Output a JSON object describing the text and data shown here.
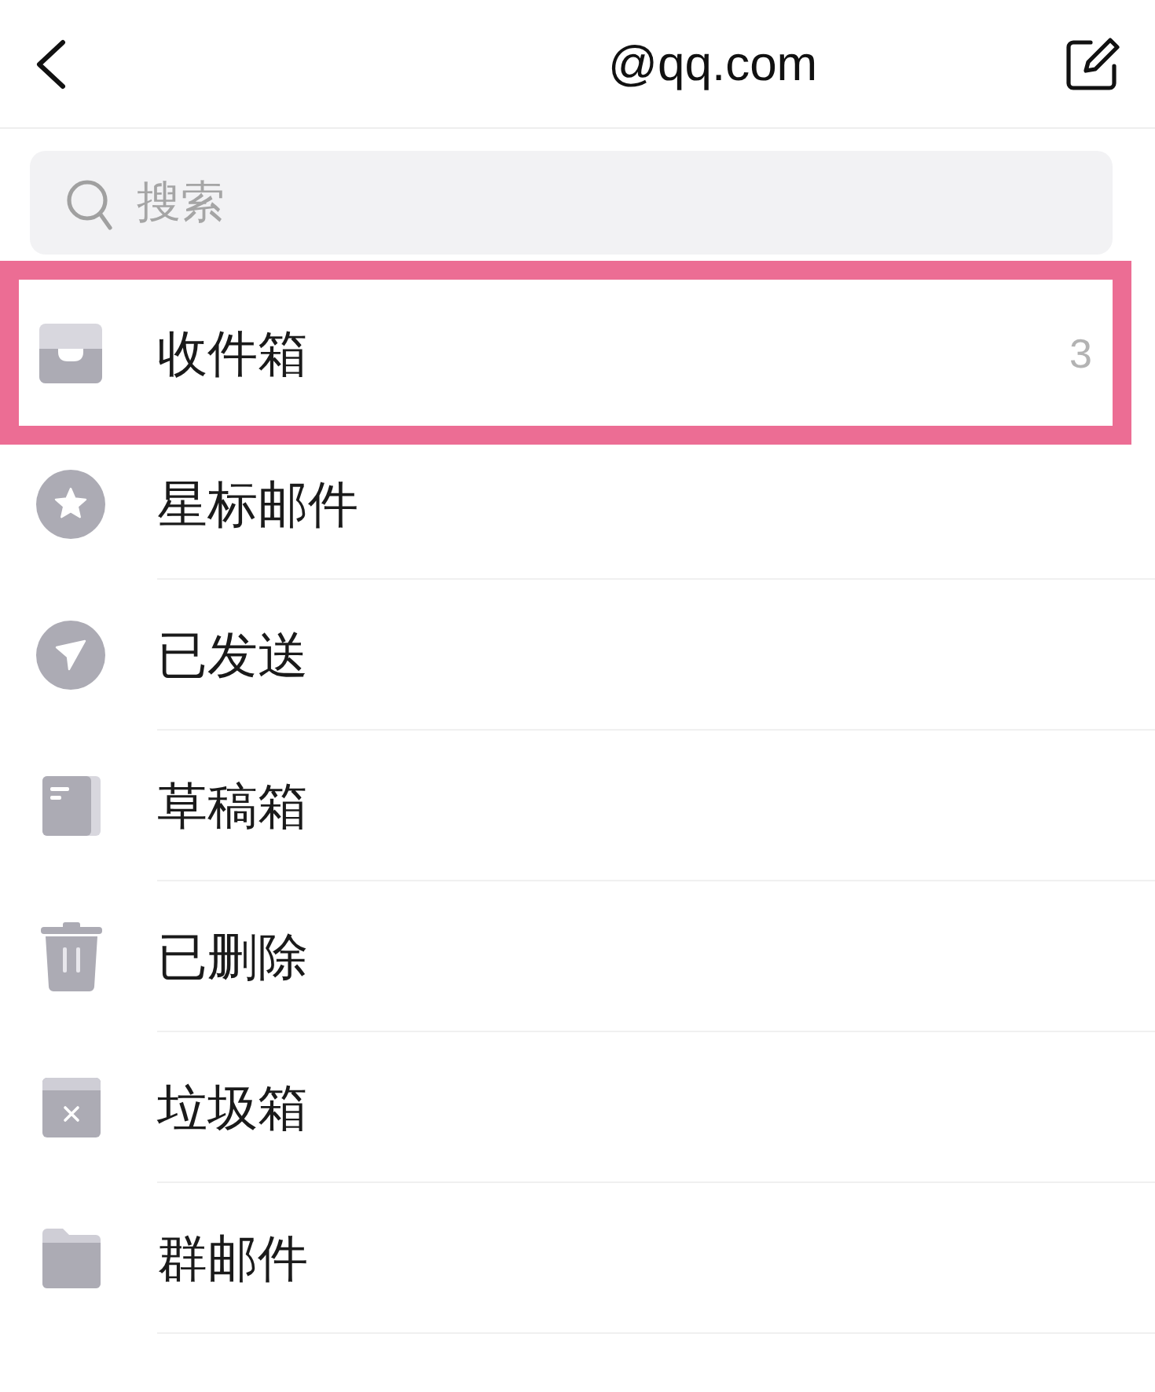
{
  "header": {
    "title": "@qq.com"
  },
  "search": {
    "placeholder": "搜索"
  },
  "folders": [
    {
      "kind": "inbox",
      "label": "收件箱",
      "count": "3",
      "highlighted": true
    },
    {
      "kind": "starred",
      "label": "星标邮件",
      "highlighted": false
    },
    {
      "kind": "sent",
      "label": "已发送",
      "highlighted": false
    },
    {
      "kind": "drafts",
      "label": "草稿箱",
      "highlighted": false
    },
    {
      "kind": "deleted",
      "label": "已删除",
      "highlighted": false
    },
    {
      "kind": "junk",
      "label": "垃圾箱",
      "highlighted": false
    },
    {
      "kind": "group",
      "label": "群邮件",
      "highlighted": false
    }
  ]
}
